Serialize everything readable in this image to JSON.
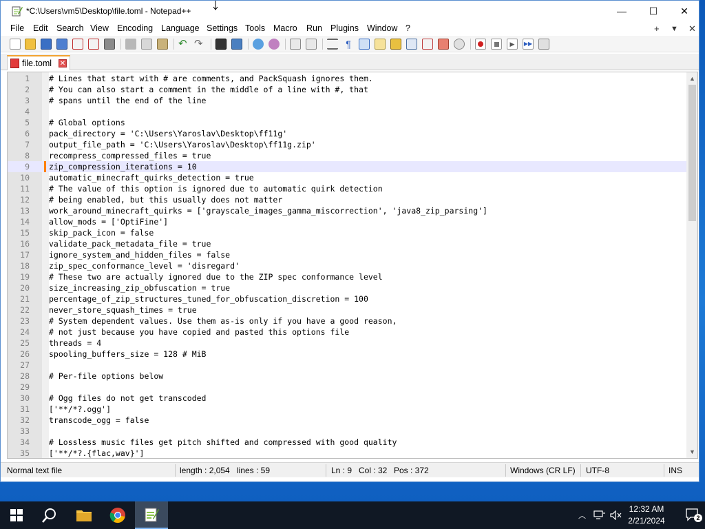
{
  "window": {
    "title": "*C:\\Users\\vm5\\Desktop\\file.toml - Notepad++",
    "minimize_label": "—",
    "maximize_label": "☐",
    "close_label": "✕"
  },
  "menu": {
    "items": [
      "File",
      "Edit",
      "Search",
      "View",
      "Encoding",
      "Language",
      "Settings",
      "Tools",
      "Macro",
      "Run",
      "Plugins",
      "Window",
      "?"
    ],
    "right_add": "+",
    "right_down": "▼",
    "right_close": "✕"
  },
  "toolbar": {
    "icons": [
      "new-file-icon",
      "open-file-icon",
      "save-icon",
      "save-all-icon",
      "close-icon",
      "close-all-icon",
      "print-icon",
      "cut-icon",
      "copy-icon",
      "paste-icon",
      "undo-icon",
      "redo-icon",
      "find-icon",
      "replace-icon",
      "zoom-in-icon",
      "zoom-out-icon",
      "sync-vertical-icon",
      "sync-horizontal-icon",
      "word-wrap-icon",
      "show-all-chars-icon",
      "indent-guide-icon",
      "user-lang-icon",
      "doc-map-icon",
      "doc-list-icon",
      "function-list-icon",
      "folder-workspace-icon",
      "monitoring-icon",
      "record-macro-icon",
      "stop-macro-icon",
      "play-macro-icon",
      "run-macro-multiple-icon",
      "save-macro-icon"
    ]
  },
  "tab": {
    "label": "file.toml",
    "close_label": "✕"
  },
  "editor": {
    "current_line": 9,
    "lines": [
      {
        "n": "1",
        "text": "# Lines that start with # are comments, and PackSquash ignores them."
      },
      {
        "n": "2",
        "text": "# You can also start a comment in the middle of a line with #, that"
      },
      {
        "n": "3",
        "text": "# spans until the end of the line"
      },
      {
        "n": "4",
        "text": ""
      },
      {
        "n": "5",
        "text": "# Global options"
      },
      {
        "n": "6",
        "text": "pack_directory = 'C:\\Users\\Yaroslav\\Desktop\\ff11g'"
      },
      {
        "n": "7",
        "text": "output_file_path = 'C:\\Users\\Yaroslav\\Desktop\\ff11g.zip'"
      },
      {
        "n": "8",
        "text": "recompress_compressed_files = true"
      },
      {
        "n": "9",
        "text": "zip_compression_iterations = 10"
      },
      {
        "n": "10",
        "text": "automatic_minecraft_quirks_detection = true"
      },
      {
        "n": "11",
        "text": "# The value of this option is ignored due to automatic quirk detection"
      },
      {
        "n": "12",
        "text": "# being enabled, but this usually does not matter"
      },
      {
        "n": "13",
        "text": "work_around_minecraft_quirks = ['grayscale_images_gamma_miscorrection', 'java8_zip_parsing']"
      },
      {
        "n": "14",
        "text": "allow_mods = ['OptiFine']"
      },
      {
        "n": "15",
        "text": "skip_pack_icon = false"
      },
      {
        "n": "16",
        "text": "validate_pack_metadata_file = true"
      },
      {
        "n": "17",
        "text": "ignore_system_and_hidden_files = false"
      },
      {
        "n": "18",
        "text": "zip_spec_conformance_level = 'disregard'"
      },
      {
        "n": "19",
        "text": "# These two are actually ignored due to the ZIP spec conformance level"
      },
      {
        "n": "20",
        "text": "size_increasing_zip_obfuscation = true"
      },
      {
        "n": "21",
        "text": "percentage_of_zip_structures_tuned_for_obfuscation_discretion = 100"
      },
      {
        "n": "22",
        "text": "never_store_squash_times = true"
      },
      {
        "n": "23",
        "text": "# System dependent values. Use them as-is only if you have a good reason,"
      },
      {
        "n": "24",
        "text": "# not just because you have copied and pasted this options file"
      },
      {
        "n": "25",
        "text": "threads = 4"
      },
      {
        "n": "26",
        "text": "spooling_buffers_size = 128 # MiB"
      },
      {
        "n": "27",
        "text": ""
      },
      {
        "n": "28",
        "text": "# Per-file options below"
      },
      {
        "n": "29",
        "text": ""
      },
      {
        "n": "30",
        "text": "# Ogg files do not get transcoded"
      },
      {
        "n": "31",
        "text": "['**/*?.ogg']"
      },
      {
        "n": "32",
        "text": "transcode_ogg = false"
      },
      {
        "n": "33",
        "text": ""
      },
      {
        "n": "34",
        "text": "# Lossless music files get pitch shifted and compressed with good quality"
      },
      {
        "n": "35",
        "text": "['**/*?.{flac,wav}']"
      }
    ]
  },
  "status": {
    "file_type": "Normal text file",
    "length": "length : 2,054",
    "lines": "lines : 59",
    "ln": "Ln : 9",
    "col": "Col : 32",
    "pos": "Pos : 372",
    "eol": "Windows (CR LF)",
    "encoding": "UTF-8",
    "mode": "INS"
  },
  "taskbar": {
    "time": "12:32 AM",
    "date": "2/21/2024",
    "notification_count": "2",
    "apps": [
      "start-icon",
      "search-icon",
      "file-explorer-icon",
      "chrome-icon",
      "notepadpp-icon"
    ]
  },
  "colors": {
    "current_line_bg": "#e8e8ff",
    "change_marker": "#ff8000",
    "tab_accent": "#f2a332",
    "taskbar_bg": "#101824"
  }
}
